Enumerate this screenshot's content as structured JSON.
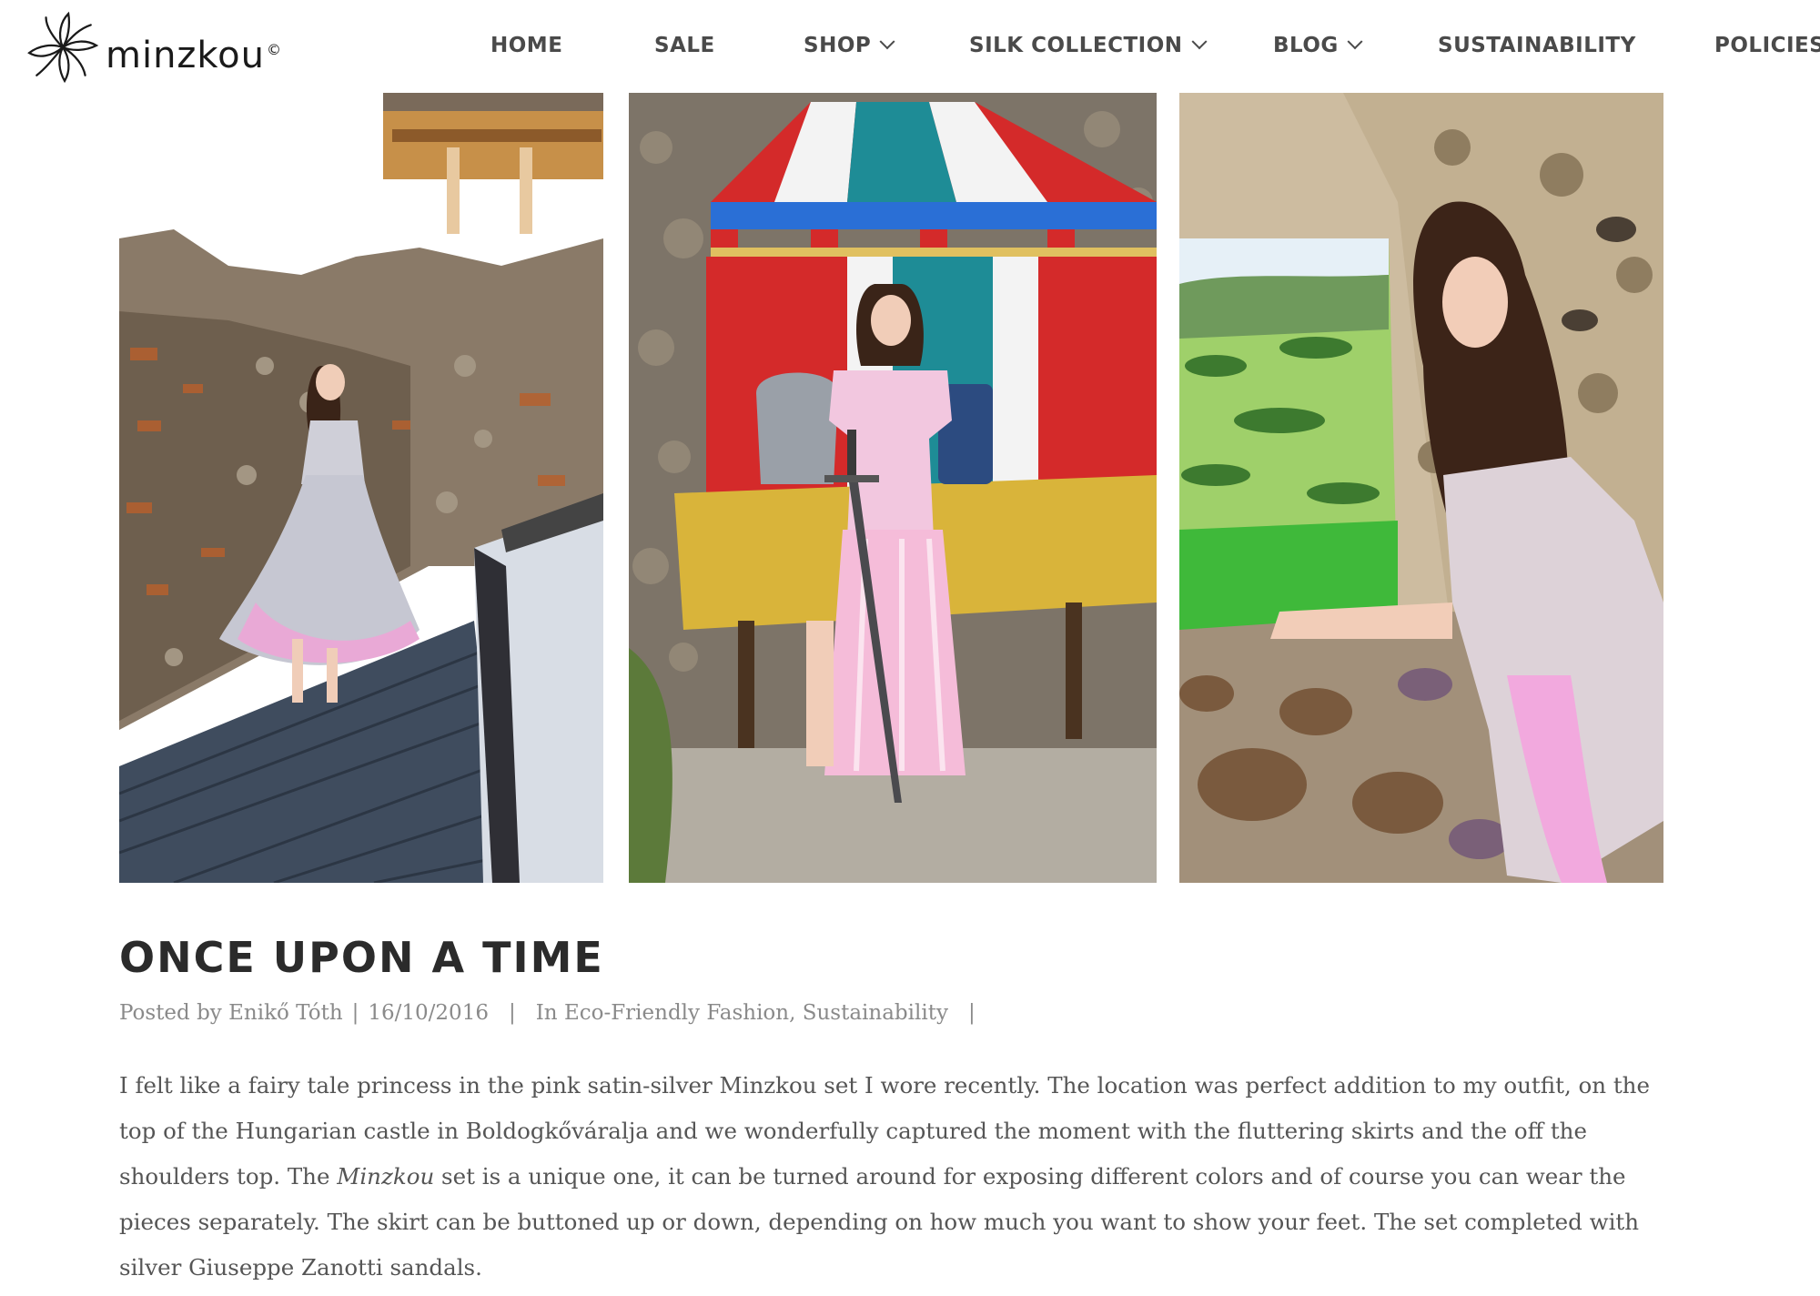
{
  "brand": {
    "name": "minzkou",
    "copyright_mark": "©"
  },
  "nav": {
    "items": [
      {
        "label": "HOME",
        "has_dropdown": false
      },
      {
        "label": "SALE",
        "has_dropdown": false
      },
      {
        "label": "SHOP",
        "has_dropdown": true
      },
      {
        "label": "SILK COLLECTION",
        "has_dropdown": true
      },
      {
        "label": "BLOG",
        "has_dropdown": true
      },
      {
        "label": "SUSTAINABILITY",
        "has_dropdown": false
      },
      {
        "label": "POLICIES",
        "has_dropdown": false
      }
    ]
  },
  "gallery": [
    {
      "icon": "photo-castle-walkway"
    },
    {
      "icon": "photo-tournament-tent"
    },
    {
      "icon": "photo-castle-window-landscape"
    }
  ],
  "post": {
    "title": "ONCE UPON A TIME",
    "posted_by_prefix": "Posted by",
    "author": "Enikő Tóth",
    "date": "16/10/2016",
    "in_prefix": "In",
    "categories": [
      "Eco-Friendly Fashion",
      "Sustainability"
    ],
    "body_lines": [
      "I felt like a fairy tale princess in the pink satin-silver Minzkou set I wore recently. The location was perfect addition to my outfit, on the",
      "top of the Hungarian castle in Boldogkőváralja and we wonderfully captured the moment with the fluttering skirts and the off the",
      "shoulders top. The",
      "Minzkou",
      " set is a unique one, it can be turned around for exposing different colors and of course you can wear the",
      "pieces separately. The skirt can be buttoned up or down, depending on how much you want to show your feet. The set completed with",
      "silver Giuseppe Zanotti sandals."
    ]
  },
  "colors": {
    "nav_text": "#4a4a4a",
    "title": "#2b2b2b",
    "meta": "#8a8a8a",
    "body": "#555555"
  }
}
